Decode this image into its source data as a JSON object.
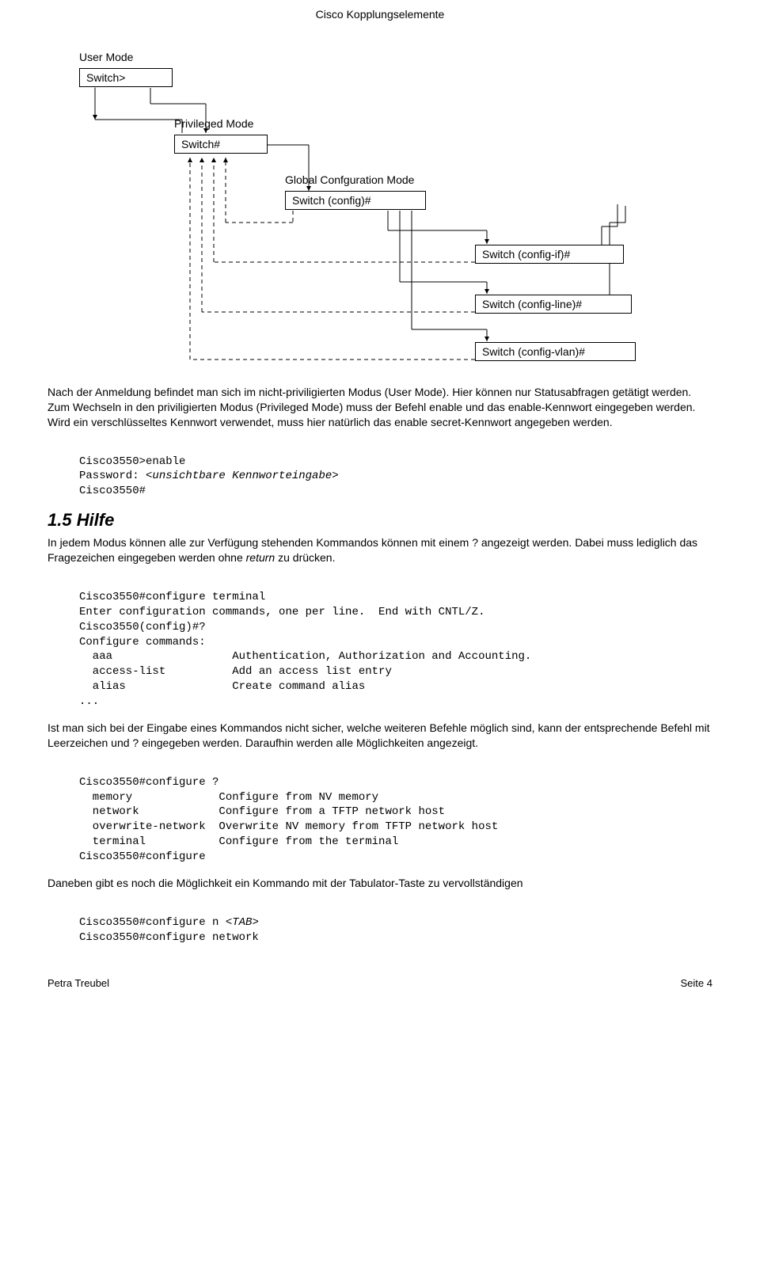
{
  "header": {
    "title": "Cisco Kopplungselemente"
  },
  "diagram": {
    "user_mode_label": "User Mode",
    "user_mode_box": "Switch>",
    "priv_mode_label": "Privileged Mode",
    "priv_mode_box": "Switch#",
    "global_mode_label": "Global Confguration Mode",
    "global_mode_box": "Switch (config)#",
    "if_box": "Switch (config-if)#",
    "line_box": "Switch (config-line)#",
    "vlan_box": "Switch (config-vlan)#"
  },
  "p1": "Nach der Anmeldung befindet man sich im nicht-priviligierten Modus (User Mode). Hier können nur Statusabfragen getätigt werden. Zum Wechseln in den priviligierten Modus (Privileged Mode) muss der Befehl enable und das enable-Kennwort eingegeben werden. Wird ein verschlüsseltes Kennwort verwendet, muss hier natürlich das enable secret-Kennwort angegeben werden.",
  "code1": {
    "l1": "Cisco3550>enable",
    "l2a": "Password: ",
    "l2b": "<unsichtbare Kennworteingabe>",
    "l3": "Cisco3550#"
  },
  "hilfe": {
    "title": "1.5 Hilfe",
    "p1a": "In jedem Modus können alle zur Verfügung stehenden Kommandos können mit einem ? angezeigt werden. Dabei muss lediglich das Fragezeichen eingegeben werden ohne ",
    "p1b": "return",
    "p1c": " zu drücken."
  },
  "code2": {
    "l1": "Cisco3550#configure terminal",
    "l2": "Enter configuration commands, one per line.  End with CNTL/Z.",
    "l3": "Cisco3550(config)#?",
    "l4": "Configure commands:",
    "l5": "  aaa                  Authentication, Authorization and Accounting.",
    "l6": "  access-list          Add an access list entry",
    "l7": "  alias                Create command alias",
    "l8": "..."
  },
  "p2": "Ist man sich bei der Eingabe eines Kommandos nicht sicher, welche weiteren Befehle möglich sind, kann der entsprechende Befehl mit Leerzeichen und ? eingegeben werden. Daraufhin werden alle Möglichkeiten angezeigt.",
  "code3": {
    "l1": "Cisco3550#configure ?",
    "l2": "  memory             Configure from NV memory",
    "l3": "  network            Configure from a TFTP network host",
    "l4": "  overwrite-network  Overwrite NV memory from TFTP network host",
    "l5": "  terminal           Configure from the terminal",
    "l6": "Cisco3550#configure"
  },
  "p3": "Daneben gibt es noch die Möglichkeit ein Kommando mit der Tabulator-Taste zu vervollständigen",
  "code4": {
    "l1a": "Cisco3550#configure n ",
    "l1b": "<TAB>",
    "l2": "Cisco3550#configure network"
  },
  "footer": {
    "left": "Petra Treubel",
    "right": "Seite 4"
  }
}
